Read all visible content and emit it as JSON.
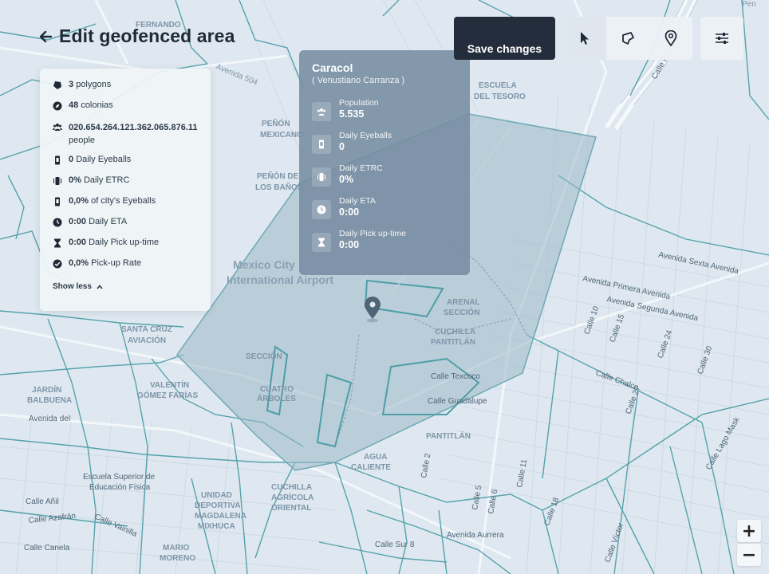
{
  "header": {
    "title": "Edit geofenced area"
  },
  "toolbar": {
    "save_label": "Save changes"
  },
  "stats": {
    "polygons": {
      "value": "3",
      "label": "polygons"
    },
    "colonias": {
      "value": "48",
      "label": "colonias"
    },
    "people": {
      "value": "020.654.264.121.362.065.876.11",
      "label": "people"
    },
    "eyeballs": {
      "value": "0",
      "label": "Daily Eyeballs"
    },
    "etrc": {
      "value": "0%",
      "label": "Daily ETRC"
    },
    "city_eyeballs": {
      "value": "0,0%",
      "label": "of city's Eyeballs"
    },
    "eta": {
      "value": "0:00",
      "label": "Daily ETA"
    },
    "pickup_time": {
      "value": "0:00",
      "label": "Daily Pick up-time"
    },
    "pickup_rate": {
      "value": "0,0%",
      "label": "Pick-up Rate"
    },
    "show_less": "Show less"
  },
  "popup": {
    "title": "Caracol",
    "subtitle": "( Venustiano Carranza )",
    "rows": [
      {
        "label": "Population",
        "value": "5.535"
      },
      {
        "label": "Daily Eyeballs",
        "value": "0"
      },
      {
        "label": "Daily ETRC",
        "value": "0%"
      },
      {
        "label": "Daily ETA",
        "value": "0:00"
      },
      {
        "label": "Daily Pick up-time",
        "value": "0:00"
      }
    ]
  },
  "zoom": {
    "in": "+",
    "out": "−"
  },
  "map": {
    "labels": {
      "airport1": "Mexico City",
      "airport2": "International Airport",
      "avenida504": "Avenida 504",
      "penon_mex1": "PEÑÓN",
      "penon_mex2": "MEXICANO",
      "penon_banos1": "PEÑÓN DE",
      "penon_banos2": "LOS BAÑOS",
      "jardin1": "JARDÍN",
      "jardin2": "BALBUENA",
      "avenida_del": "Avenida del",
      "escuela1": "Escuela Superior de",
      "escuela2": "Educación Física",
      "calle_anil": "Calle Añil",
      "calle_azafran": "Calle Azafrán",
      "calle_vainilla": "Calle Vainilla",
      "calle_canela": "Calle Canela",
      "unidad1": "UNIDAD",
      "unidad2": "DEPORTIVA",
      "unidad3": "MAGDALENA",
      "unidad4": "MIXHUCA",
      "mario1": "MARIO",
      "mario2": "MORENO",
      "cuchilla1": "CUCHILLA",
      "cuchilla2": "AGRÍCOLA",
      "cuchilla3": "ORIENTAL",
      "agua1": "AGUA",
      "agua2": "CALIENTE",
      "calle_sur8": "Calle Sur 8",
      "avenida_aurrera": "Avenida Aurrera",
      "pantitlan": "PANTITLÁN",
      "cuchilla_pant1": "CUCHILLA",
      "cuchilla_pant2": "PANTITLÁN",
      "arenal1": "ARENAL",
      "arenal2": "SECCIÓN",
      "tesoro1": "ESCUELA",
      "tesoro2": "DEL TESORO",
      "calle_texcoco": "Calle Texcoco",
      "calle_guadalupe": "Calle Guadalupe",
      "avenida_sexta": "Avenida Sexta Avenida",
      "avenida_primera": "Avenida Primera Avenida",
      "avenida_segunda": "Avenida Segunda Avenida",
      "calle_chalco": "Calle Chalco",
      "calle_lago_mask": "Calle Lago Mask",
      "calle_victor": "Calle Víctor",
      "calle_peniston": "Calle Peniston",
      "santa_cruz1": "SANTA CRUZ",
      "santa_cruz2": "AVIACIÓN",
      "valentin1": "VALENTÍN",
      "valentin2": "GÓMEZ FARÍAS",
      "calle5": "Calle 5",
      "calle6": "Calle 6",
      "calle2": "Calle 2",
      "calle10": "Calle 10",
      "calle15": "Calle 15",
      "calle24": "Calle 24",
      "calle30": "Calle 30",
      "calle18": "Calle 18",
      "calle27": "Calle 27",
      "calle11": "Calle 11",
      "sec": "SECCIÓN",
      "angeles1": "CUATRO",
      "angeles2": "ÁRBOLES",
      "nandop": "FERNANDO",
      "pen": "Pen"
    }
  }
}
